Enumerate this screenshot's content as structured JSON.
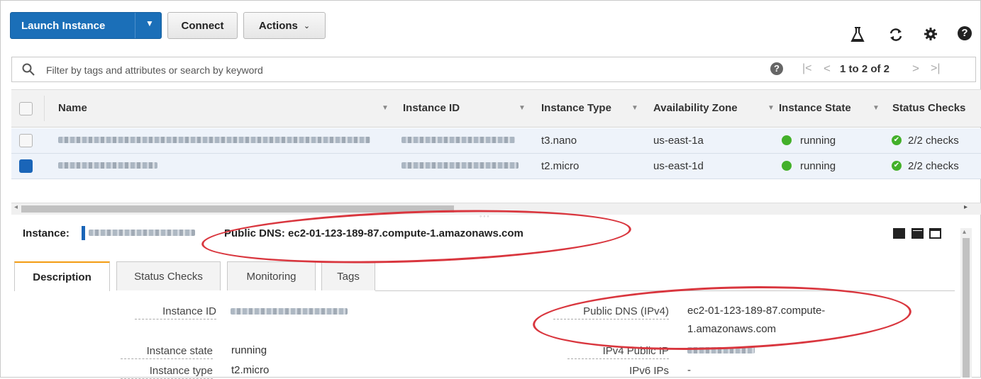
{
  "toolbar": {
    "launch_label": "Launch Instance",
    "connect_label": "Connect",
    "actions_label": "Actions"
  },
  "search": {
    "placeholder": "Filter by tags and attributes or search by keyword",
    "pagination": "1 to 2 of 2"
  },
  "table": {
    "headers": [
      "Name",
      "Instance ID",
      "Instance Type",
      "Availability Zone",
      "Instance State",
      "Status Checks"
    ],
    "rows": [
      {
        "type": "t3.nano",
        "zone": "us-east-1a",
        "state": "running",
        "checks": "2/2 checks",
        "selected": false
      },
      {
        "type": "t2.micro",
        "zone": "us-east-1d",
        "state": "running",
        "checks": "2/2 checks",
        "selected": true
      }
    ]
  },
  "detail": {
    "instance_label": "Instance:",
    "public_dns_header": "Public DNS: ec2-01-123-189-87.compute-1.amazonaws.com",
    "tabs": [
      "Description",
      "Status Checks",
      "Monitoring",
      "Tags"
    ],
    "fields": {
      "instance_id_label": "Instance ID",
      "instance_state_label": "Instance state",
      "instance_state_value": "running",
      "instance_type_label": "Instance type",
      "instance_type_value": "t2.micro",
      "public_dns_label": "Public DNS (IPv4)",
      "public_dns_value_line1": "ec2-01-123-189-87.compute-",
      "public_dns_value_line2": "1.amazonaws.com",
      "ipv4_label": "IPv4 Public IP",
      "ipv6_label": "IPv6 IPs",
      "ipv6_value": "-"
    }
  },
  "colors": {
    "primary": "#1b6fb8",
    "running": "#43b02a",
    "highlight": "#d9363e",
    "active_tab": "#f39c12"
  },
  "icons": [
    "flask-icon",
    "refresh-icon",
    "gear-icon",
    "help-icon",
    "search-icon",
    "chevron-down-icon"
  ]
}
